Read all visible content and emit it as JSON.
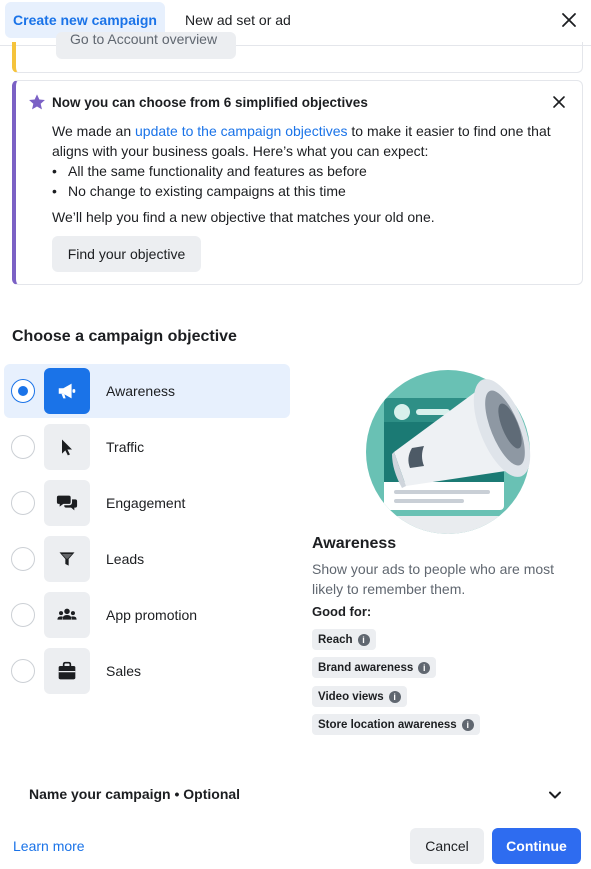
{
  "tabs": {
    "active_label": "Create new campaign",
    "second_label": "New ad set or ad"
  },
  "yellow_card": {
    "button_label": "Go to Account overview"
  },
  "notice": {
    "title": "Now you can choose from 6 simplified objectives",
    "body_prefix": "We made an ",
    "body_link": "update to the campaign objectives",
    "body_suffix": " to make it easier to find one that aligns with your business goals. Here’s what you can expect:",
    "bullets": [
      "All the same functionality and features as before",
      "No change to existing campaigns at this time"
    ],
    "help_text": "We’ll help you find a new objective that matches your old one.",
    "button_label": "Find your objective",
    "accent_color": "#7b61c5"
  },
  "objective_section": {
    "title": "Choose a campaign objective",
    "selected_index": 0,
    "items": [
      {
        "label": "Awareness",
        "icon": "megaphone-icon"
      },
      {
        "label": "Traffic",
        "icon": "cursor-icon"
      },
      {
        "label": "Engagement",
        "icon": "chat-bubbles-icon"
      },
      {
        "label": "Leads",
        "icon": "funnel-icon"
      },
      {
        "label": "App promotion",
        "icon": "people-icon"
      },
      {
        "label": "Sales",
        "icon": "shopping-bag-icon"
      }
    ]
  },
  "description": {
    "title": "Awareness",
    "text": "Show your ads to people who are most likely to remember them.",
    "good_for_label": "Good for:",
    "chips": [
      "Reach",
      "Brand awareness",
      "Video views",
      "Store location awareness"
    ]
  },
  "name_campaign": {
    "label": "Name your campaign • Optional"
  },
  "footer": {
    "learn_more": "Learn more",
    "cancel": "Cancel",
    "continue": "Continue"
  },
  "colors": {
    "primary": "#1a73e8",
    "continue_bg": "#2e6cf0",
    "selected_bg": "#e7f0fd",
    "yellow_accent": "#f5c33b"
  }
}
